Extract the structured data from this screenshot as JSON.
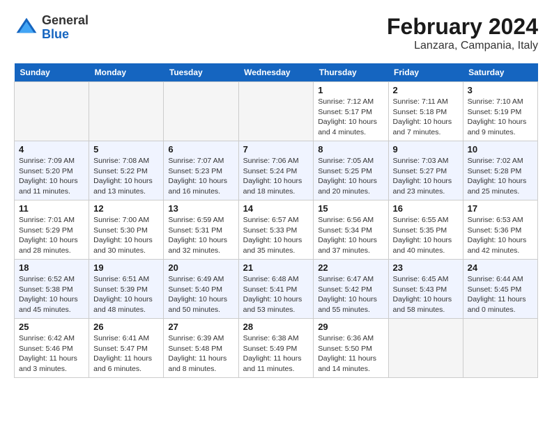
{
  "header": {
    "logo_general": "General",
    "logo_blue": "Blue",
    "month_year": "February 2024",
    "location": "Lanzara, Campania, Italy"
  },
  "days_of_week": [
    "Sunday",
    "Monday",
    "Tuesday",
    "Wednesday",
    "Thursday",
    "Friday",
    "Saturday"
  ],
  "weeks": [
    [
      {
        "day": "",
        "info": ""
      },
      {
        "day": "",
        "info": ""
      },
      {
        "day": "",
        "info": ""
      },
      {
        "day": "",
        "info": ""
      },
      {
        "day": "1",
        "info": "Sunrise: 7:12 AM\nSunset: 5:17 PM\nDaylight: 10 hours\nand 4 minutes."
      },
      {
        "day": "2",
        "info": "Sunrise: 7:11 AM\nSunset: 5:18 PM\nDaylight: 10 hours\nand 7 minutes."
      },
      {
        "day": "3",
        "info": "Sunrise: 7:10 AM\nSunset: 5:19 PM\nDaylight: 10 hours\nand 9 minutes."
      }
    ],
    [
      {
        "day": "4",
        "info": "Sunrise: 7:09 AM\nSunset: 5:20 PM\nDaylight: 10 hours\nand 11 minutes."
      },
      {
        "day": "5",
        "info": "Sunrise: 7:08 AM\nSunset: 5:22 PM\nDaylight: 10 hours\nand 13 minutes."
      },
      {
        "day": "6",
        "info": "Sunrise: 7:07 AM\nSunset: 5:23 PM\nDaylight: 10 hours\nand 16 minutes."
      },
      {
        "day": "7",
        "info": "Sunrise: 7:06 AM\nSunset: 5:24 PM\nDaylight: 10 hours\nand 18 minutes."
      },
      {
        "day": "8",
        "info": "Sunrise: 7:05 AM\nSunset: 5:25 PM\nDaylight: 10 hours\nand 20 minutes."
      },
      {
        "day": "9",
        "info": "Sunrise: 7:03 AM\nSunset: 5:27 PM\nDaylight: 10 hours\nand 23 minutes."
      },
      {
        "day": "10",
        "info": "Sunrise: 7:02 AM\nSunset: 5:28 PM\nDaylight: 10 hours\nand 25 minutes."
      }
    ],
    [
      {
        "day": "11",
        "info": "Sunrise: 7:01 AM\nSunset: 5:29 PM\nDaylight: 10 hours\nand 28 minutes."
      },
      {
        "day": "12",
        "info": "Sunrise: 7:00 AM\nSunset: 5:30 PM\nDaylight: 10 hours\nand 30 minutes."
      },
      {
        "day": "13",
        "info": "Sunrise: 6:59 AM\nSunset: 5:31 PM\nDaylight: 10 hours\nand 32 minutes."
      },
      {
        "day": "14",
        "info": "Sunrise: 6:57 AM\nSunset: 5:33 PM\nDaylight: 10 hours\nand 35 minutes."
      },
      {
        "day": "15",
        "info": "Sunrise: 6:56 AM\nSunset: 5:34 PM\nDaylight: 10 hours\nand 37 minutes."
      },
      {
        "day": "16",
        "info": "Sunrise: 6:55 AM\nSunset: 5:35 PM\nDaylight: 10 hours\nand 40 minutes."
      },
      {
        "day": "17",
        "info": "Sunrise: 6:53 AM\nSunset: 5:36 PM\nDaylight: 10 hours\nand 42 minutes."
      }
    ],
    [
      {
        "day": "18",
        "info": "Sunrise: 6:52 AM\nSunset: 5:38 PM\nDaylight: 10 hours\nand 45 minutes."
      },
      {
        "day": "19",
        "info": "Sunrise: 6:51 AM\nSunset: 5:39 PM\nDaylight: 10 hours\nand 48 minutes."
      },
      {
        "day": "20",
        "info": "Sunrise: 6:49 AM\nSunset: 5:40 PM\nDaylight: 10 hours\nand 50 minutes."
      },
      {
        "day": "21",
        "info": "Sunrise: 6:48 AM\nSunset: 5:41 PM\nDaylight: 10 hours\nand 53 minutes."
      },
      {
        "day": "22",
        "info": "Sunrise: 6:47 AM\nSunset: 5:42 PM\nDaylight: 10 hours\nand 55 minutes."
      },
      {
        "day": "23",
        "info": "Sunrise: 6:45 AM\nSunset: 5:43 PM\nDaylight: 10 hours\nand 58 minutes."
      },
      {
        "day": "24",
        "info": "Sunrise: 6:44 AM\nSunset: 5:45 PM\nDaylight: 11 hours\nand 0 minutes."
      }
    ],
    [
      {
        "day": "25",
        "info": "Sunrise: 6:42 AM\nSunset: 5:46 PM\nDaylight: 11 hours\nand 3 minutes."
      },
      {
        "day": "26",
        "info": "Sunrise: 6:41 AM\nSunset: 5:47 PM\nDaylight: 11 hours\nand 6 minutes."
      },
      {
        "day": "27",
        "info": "Sunrise: 6:39 AM\nSunset: 5:48 PM\nDaylight: 11 hours\nand 8 minutes."
      },
      {
        "day": "28",
        "info": "Sunrise: 6:38 AM\nSunset: 5:49 PM\nDaylight: 11 hours\nand 11 minutes."
      },
      {
        "day": "29",
        "info": "Sunrise: 6:36 AM\nSunset: 5:50 PM\nDaylight: 11 hours\nand 14 minutes."
      },
      {
        "day": "",
        "info": ""
      },
      {
        "day": "",
        "info": ""
      }
    ]
  ]
}
